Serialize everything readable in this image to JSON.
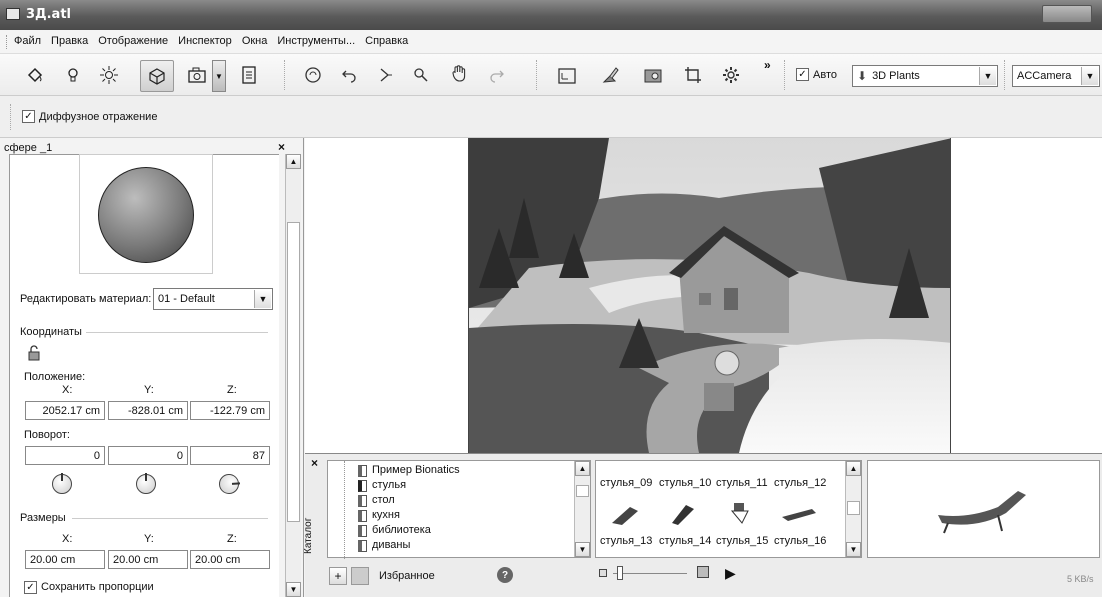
{
  "window": {
    "title": "3Д.atl"
  },
  "menu": [
    "Файл",
    "Правка",
    "Отображение",
    "Инспектор",
    "Окна",
    "Инструменты...",
    "Справка"
  ],
  "toolbar": {
    "auto_label": "Авто",
    "auto_checked": true,
    "plants_combo": "3D Plants",
    "camera_combo": "ACCamera",
    "overflow": "»"
  },
  "subbar": {
    "diffuse_label": "Диффузное отражение",
    "diffuse_checked": true
  },
  "inspector": {
    "object_name": "сфере _1",
    "close": "×",
    "edit_material_label": "Редактировать материал:",
    "material_value": "01 - Default",
    "coordinates_heading": "Координаты",
    "position_label": "Положение:",
    "axis_x": "X:",
    "axis_y": "Y:",
    "axis_z": "Z:",
    "position": {
      "x": "2052.17 cm",
      "y": "-828.01 cm",
      "z": "-122.79 cm"
    },
    "rotation_label": "Поворот:",
    "rotation": {
      "x": "0",
      "y": "0",
      "z": "87"
    },
    "sizes_heading": "Размеры",
    "sizes": {
      "x": "20.00 cm",
      "y": "20.00 cm",
      "z": "20.00 cm"
    },
    "keep_proportions": "Сохранить пропорции"
  },
  "catalog": {
    "side_label": "Каталог",
    "close": "×",
    "tree": [
      "Пример Bionatics",
      "стулья",
      "стол",
      "кухня",
      "библиотека",
      "диваны"
    ],
    "thumbs_row1": [
      "стулья_09",
      "стулья_10",
      "стулья_11",
      "стулья_12"
    ],
    "thumbs_row2": [
      "стулья_13",
      "стулья_14",
      "стулья_15",
      "стулья_16"
    ],
    "favorites_label": "Избранное",
    "add_label": "+",
    "help": "?",
    "play": "▶"
  },
  "status": {
    "net_speed": "5 KB/s"
  }
}
